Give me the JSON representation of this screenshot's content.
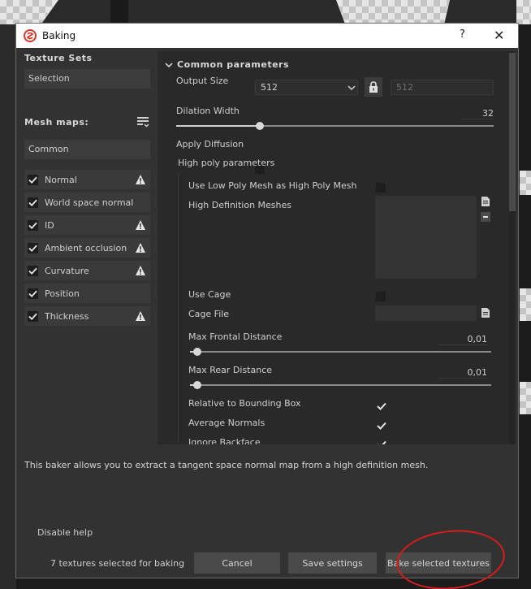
{
  "dialog": {
    "title": "Baking",
    "help_icon": "?",
    "close_icon": "✕"
  },
  "left": {
    "texture_sets_title": "Texture Sets",
    "texture_sets_selected": "Selection",
    "mesh_maps_title": "Mesh maps:",
    "common_label": "Common",
    "items": [
      {
        "label": "Normal",
        "checked": true,
        "warning": true
      },
      {
        "label": "World space normal",
        "checked": true,
        "warning": false
      },
      {
        "label": "ID",
        "checked": true,
        "warning": true
      },
      {
        "label": "Ambient occlusion",
        "checked": true,
        "warning": true
      },
      {
        "label": "Curvature",
        "checked": true,
        "warning": true
      },
      {
        "label": "Position",
        "checked": true,
        "warning": false
      },
      {
        "label": "Thickness",
        "checked": true,
        "warning": true
      }
    ]
  },
  "params": {
    "section_title": "Common parameters",
    "output_size_label": "Output Size",
    "output_size_value": "512",
    "output_size_locked_value": "512",
    "dilation_label": "Dilation Width",
    "dilation_value": "32",
    "dilation_fraction": 0.25,
    "apply_diffusion_label": "Apply Diffusion",
    "high_poly_title": "High poly parameters",
    "use_low_poly_label": "Use Low Poly Mesh as High Poly Mesh",
    "hd_meshes_label": "High Definition Meshes",
    "use_cage_label": "Use Cage",
    "cage_file_label": "Cage File",
    "max_frontal_label": "Max Frontal Distance",
    "max_frontal_value": "0,01",
    "max_frontal_fraction": 0.01,
    "max_rear_label": "Max Rear Distance",
    "max_rear_value": "0,01",
    "max_rear_fraction": 0.01,
    "relative_bbox_label": "Relative to Bounding Box",
    "average_normals_label": "Average Normals",
    "ignore_backface_label": "Ignore Backface"
  },
  "help_text": "This baker allows you to extract a tangent space normal map from a high definition mesh.",
  "footer": {
    "disable_help": "Disable help",
    "count_text": "7 textures selected for baking",
    "cancel": "Cancel",
    "save_settings": "Save settings",
    "bake": "Bake selected textures"
  },
  "colors": {
    "annotation": "#d81c1c",
    "logo": "#d9352b"
  }
}
